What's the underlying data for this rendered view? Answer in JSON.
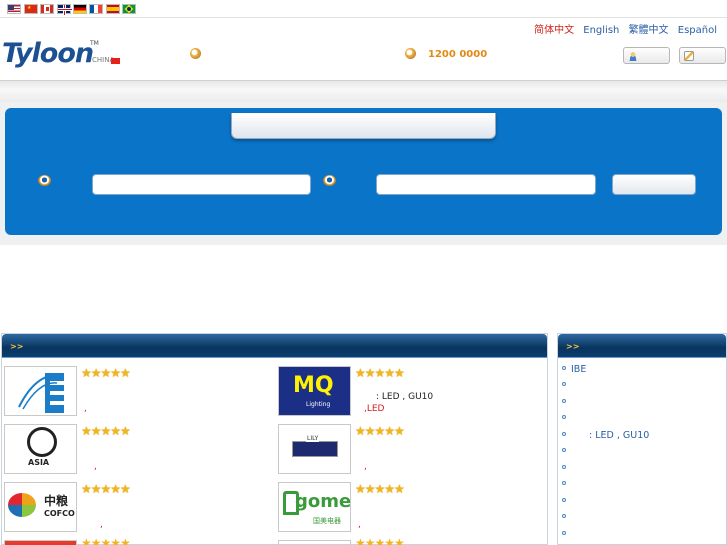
{
  "flags": [
    {
      "name": "us-flag-icon",
      "color": "#3c3b6e"
    },
    {
      "name": "china-flag-icon",
      "color": "#de2910"
    },
    {
      "name": "canada-flag-icon",
      "color": "#d52b1e"
    },
    {
      "name": "uk-flag-icon",
      "color": "#012169"
    },
    {
      "name": "germany-flag-icon",
      "color": "#000000"
    },
    {
      "name": "france-flag-icon",
      "color": "#0055a4"
    },
    {
      "name": "spain-flag-icon",
      "color": "#c60b1e"
    },
    {
      "name": "brazil-flag-icon",
      "color": "#009c3b"
    }
  ],
  "languages": {
    "simplified": "简体中文",
    "english": "English",
    "traditional": "繁體中文",
    "spanish": "Español"
  },
  "brand": {
    "logo": "Tyloon",
    "tm": "TM",
    "country": "CHINA"
  },
  "header": {
    "phone": "1200 0000"
  },
  "search": {
    "keyword_value": "",
    "location_value": "",
    "button_label": ""
  },
  "sections": {
    "products_arrow": ">>",
    "news_arrow": ">>"
  },
  "products": [
    {
      "logo": "e-logo",
      "rating": "★★★★★",
      "line1": "",
      "line2": ","
    },
    {
      "logo": "mq-lighting-logo",
      "rating": "★★★★★",
      "line1": ":    LED , GU10",
      "line2": ",LED"
    },
    {
      "logo": "asia-logo",
      "rating": "★★★★★",
      "line1": "",
      "line2": ","
    },
    {
      "logo": "lily-logo",
      "rating": "★★★★★",
      "line1": "",
      "line2": ","
    },
    {
      "logo": "cofco-logo",
      "rating": "★★★★★",
      "line1": "",
      "line2": ","
    },
    {
      "logo": "gome-logo",
      "rating": "★★★★★",
      "line1": "",
      "line2": ","
    }
  ],
  "product_logos": {
    "mq_main": "MQ",
    "mq_sub": "Lighting",
    "asia": "ASIA",
    "lily": "LILY",
    "cofco_cn": "中粮",
    "cofco": "COFCO",
    "gome": "gome",
    "gome_cn": "国美电器"
  },
  "news": [
    "IBE",
    "",
    "",
    "",
    ":    LED , GU10",
    "",
    "",
    "",
    "",
    "",
    ""
  ]
}
